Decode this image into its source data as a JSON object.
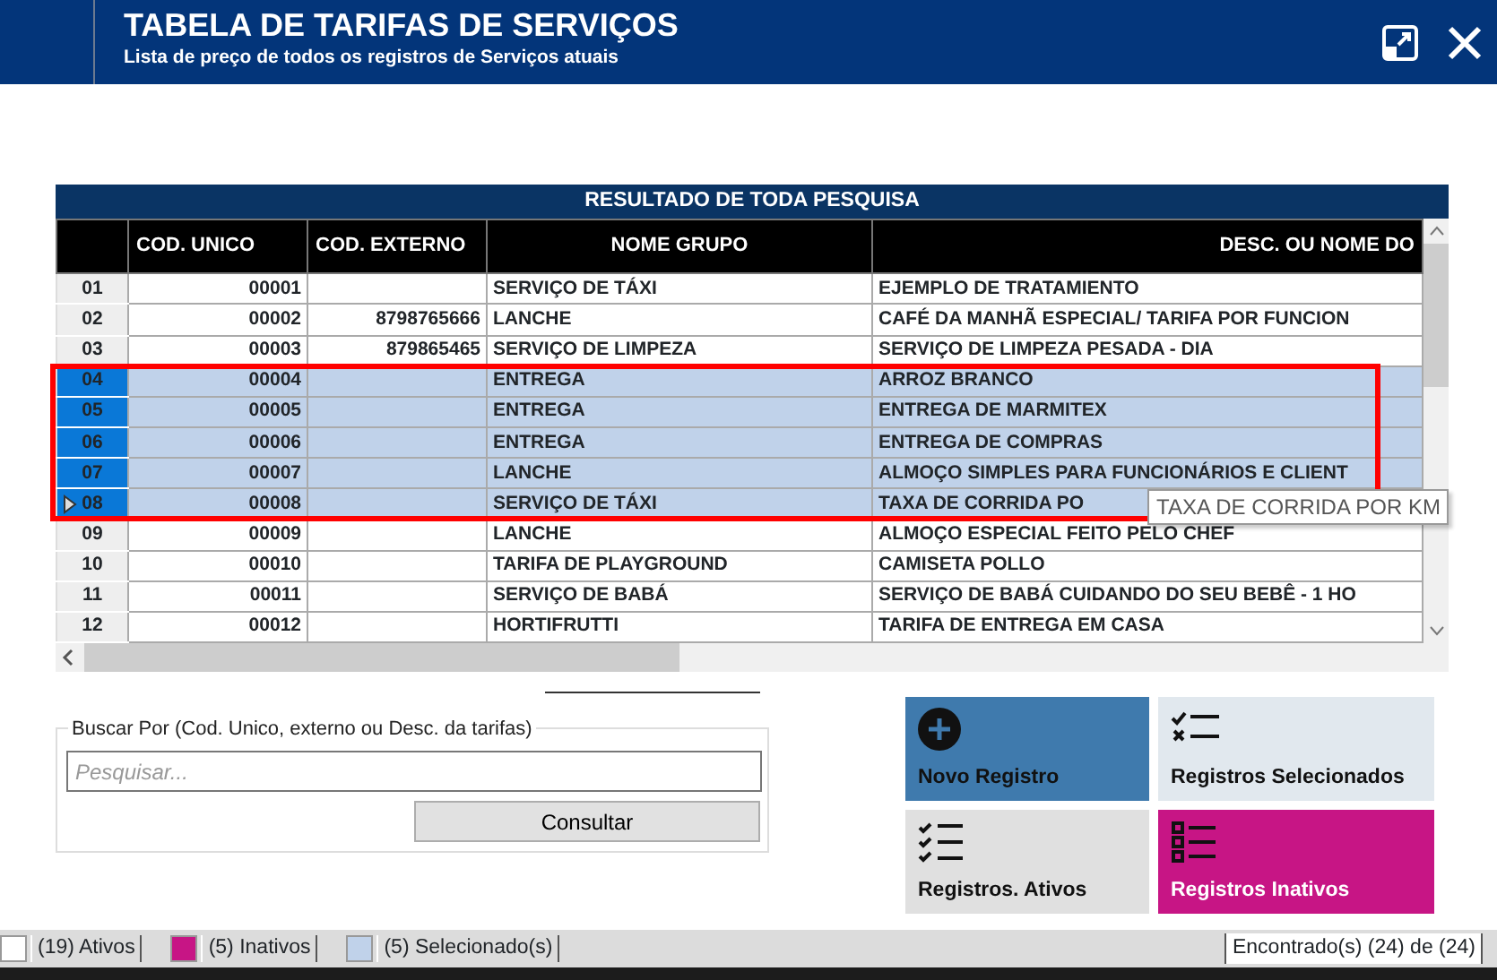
{
  "window": {
    "title": "TABELA DE TARIFAS DE SERVIÇOS",
    "subtitle": "Lista de preço de todos os registros de Serviços atuais"
  },
  "table": {
    "title": "RESULTADO DE TODA PESQUISA",
    "columns": [
      "COD. UNICO",
      "COD. EXTERNO",
      "NOME GRUPO",
      "DESC. OU NOME DO"
    ],
    "rows": [
      {
        "num": "01",
        "cod_unico": "00001",
        "cod_externo": "",
        "nome_grupo": "SERVIÇO DE TÁXI",
        "desc": "EJEMPLO DE TRATAMIENTO",
        "selected": false,
        "current": false
      },
      {
        "num": "02",
        "cod_unico": "00002",
        "cod_externo": "8798765666",
        "nome_grupo": "LANCHE",
        "desc": "CAFÉ DA MANHÃ ESPECIAL/ TARIFA POR FUNCION",
        "selected": false,
        "current": false
      },
      {
        "num": "03",
        "cod_unico": "00003",
        "cod_externo": "879865465",
        "nome_grupo": "SERVIÇO DE LIMPEZA",
        "desc": "SERVIÇO  DE LIMPEZA PESADA - DIA",
        "selected": false,
        "current": false
      },
      {
        "num": "04",
        "cod_unico": "00004",
        "cod_externo": "",
        "nome_grupo": "ENTREGA",
        "desc": "ARROZ BRANCO",
        "selected": true,
        "current": false
      },
      {
        "num": "05",
        "cod_unico": "00005",
        "cod_externo": "",
        "nome_grupo": "ENTREGA",
        "desc": "ENTREGA DE MARMITEX",
        "selected": true,
        "current": false
      },
      {
        "num": "06",
        "cod_unico": "00006",
        "cod_externo": "",
        "nome_grupo": "ENTREGA",
        "desc": "ENTREGA DE COMPRAS",
        "selected": true,
        "current": false
      },
      {
        "num": "07",
        "cod_unico": "00007",
        "cod_externo": "",
        "nome_grupo": "LANCHE",
        "desc": "ALMOÇO SIMPLES PARA FUNCIONÁRIOS E CLIENT",
        "selected": true,
        "current": false
      },
      {
        "num": "08",
        "cod_unico": "00008",
        "cod_externo": "",
        "nome_grupo": "SERVIÇO DE TÁXI",
        "desc": "TAXA DE CORRIDA PO",
        "selected": true,
        "current": true
      },
      {
        "num": "09",
        "cod_unico": "00009",
        "cod_externo": "",
        "nome_grupo": "LANCHE",
        "desc": "ALMOÇO ESPECIAL FEITO PELO CHEF",
        "selected": false,
        "current": false
      },
      {
        "num": "10",
        "cod_unico": "00010",
        "cod_externo": "",
        "nome_grupo": "TARIFA DE PLAYGROUND",
        "desc": "CAMISETA POLLO",
        "selected": false,
        "current": false
      },
      {
        "num": "11",
        "cod_unico": "00011",
        "cod_externo": "",
        "nome_grupo": "SERVIÇO DE BABÁ",
        "desc": "SERVIÇO DE BABÁ CUIDANDO DO SEU BEBÊ - 1 HO",
        "selected": false,
        "current": false
      },
      {
        "num": "12",
        "cod_unico": "00012",
        "cod_externo": "",
        "nome_grupo": "HORTIFRUTTI",
        "desc": "TARIFA DE ENTREGA EM CASA",
        "selected": false,
        "current": false
      }
    ],
    "tooltip": "TAXA DE CORRIDA POR KM"
  },
  "search": {
    "legend": "Buscar Por (Cod. Unico, externo ou Desc. da tarifas)",
    "placeholder": "Pesquisar...",
    "button": "Consultar"
  },
  "tiles": [
    {
      "kind": "add",
      "label": "Novo Registro",
      "color": "#3f7aad"
    },
    {
      "kind": "selected",
      "label": "Registros Selecionados",
      "color": "#e1e8ee"
    },
    {
      "kind": "active",
      "label": "Registros. Ativos",
      "color": "#e0e0e0"
    },
    {
      "kind": "inactive",
      "label": "Registros Inativos",
      "color": "#c71585"
    }
  ],
  "status_bar": {
    "legend": [
      {
        "color": "#ffffff",
        "label": "(19) Ativos"
      },
      {
        "color": "#c71585",
        "label": "(5) Inativos"
      },
      {
        "color": "#c0d2ea",
        "label": "(5) Selecionado(s)"
      }
    ],
    "found": "Encontrado(s)  (24) de (24)"
  }
}
